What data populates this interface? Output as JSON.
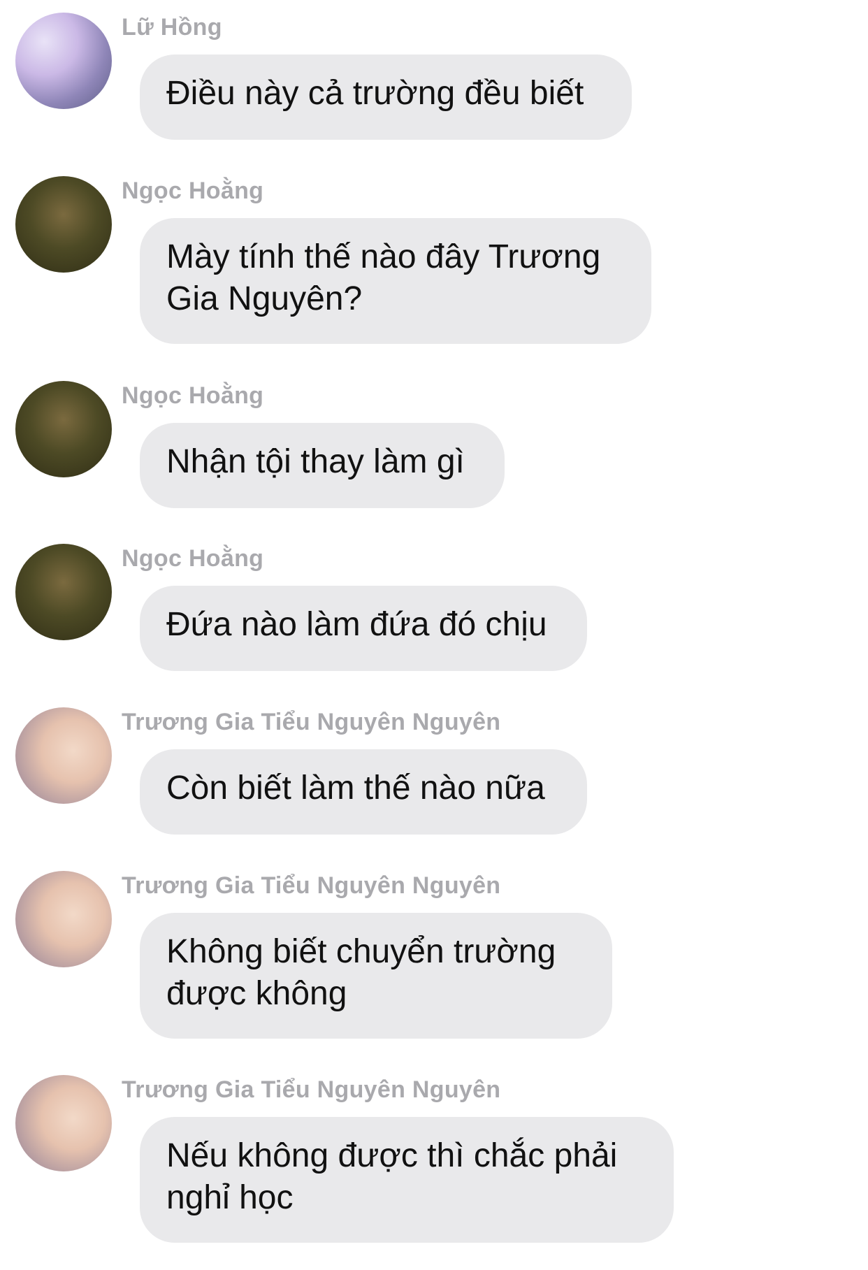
{
  "messages": [
    {
      "sender": "Lữ Hồng",
      "avatar": "avatar-lu-hong",
      "text": "Điều này cả trường đều biết"
    },
    {
      "sender": "Ngọc Hoằng",
      "avatar": "avatar-ngoc-hoang",
      "text": "Mày tính thế nào đây Trương Gia Nguyên?"
    },
    {
      "sender": "Ngọc Hoằng",
      "avatar": "avatar-ngoc-hoang",
      "text": "Nhận tội thay làm gì"
    },
    {
      "sender": "Ngọc Hoằng",
      "avatar": "avatar-ngoc-hoang",
      "text": "Đứa nào làm đứa đó chịu"
    },
    {
      "sender": "Trương Gia Tiểu Nguyên Nguyên",
      "avatar": "avatar-truong-gia",
      "text": "Còn biết làm thế nào nữa"
    },
    {
      "sender": "Trương Gia Tiểu Nguyên Nguyên",
      "avatar": "avatar-truong-gia",
      "text": "Không biết chuyển trường được không"
    },
    {
      "sender": "Trương Gia Tiểu Nguyên Nguyên",
      "avatar": "avatar-truong-gia",
      "text": "Nếu không được thì chắc phải nghỉ học"
    }
  ]
}
